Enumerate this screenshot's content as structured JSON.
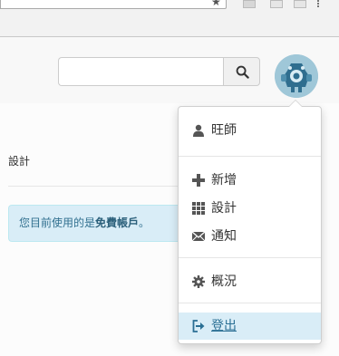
{
  "search": {
    "placeholder": "",
    "value": ""
  },
  "page": {
    "design_label": "設計",
    "alert_prefix": "您目前使用的是",
    "alert_bold": "免費帳戶",
    "alert_suffix": "。"
  },
  "menu": {
    "user": "旺師",
    "new": "新增",
    "design": "設計",
    "notify": "通知",
    "overview": "概況",
    "logout": "登出"
  },
  "colors": {
    "alert_bg": "#d9edf7",
    "alert_text": "#31708f",
    "active_item_bg": "#d9edf7",
    "logout_text": "#2a6f94",
    "avatar_bg": "#9fc7d8"
  }
}
